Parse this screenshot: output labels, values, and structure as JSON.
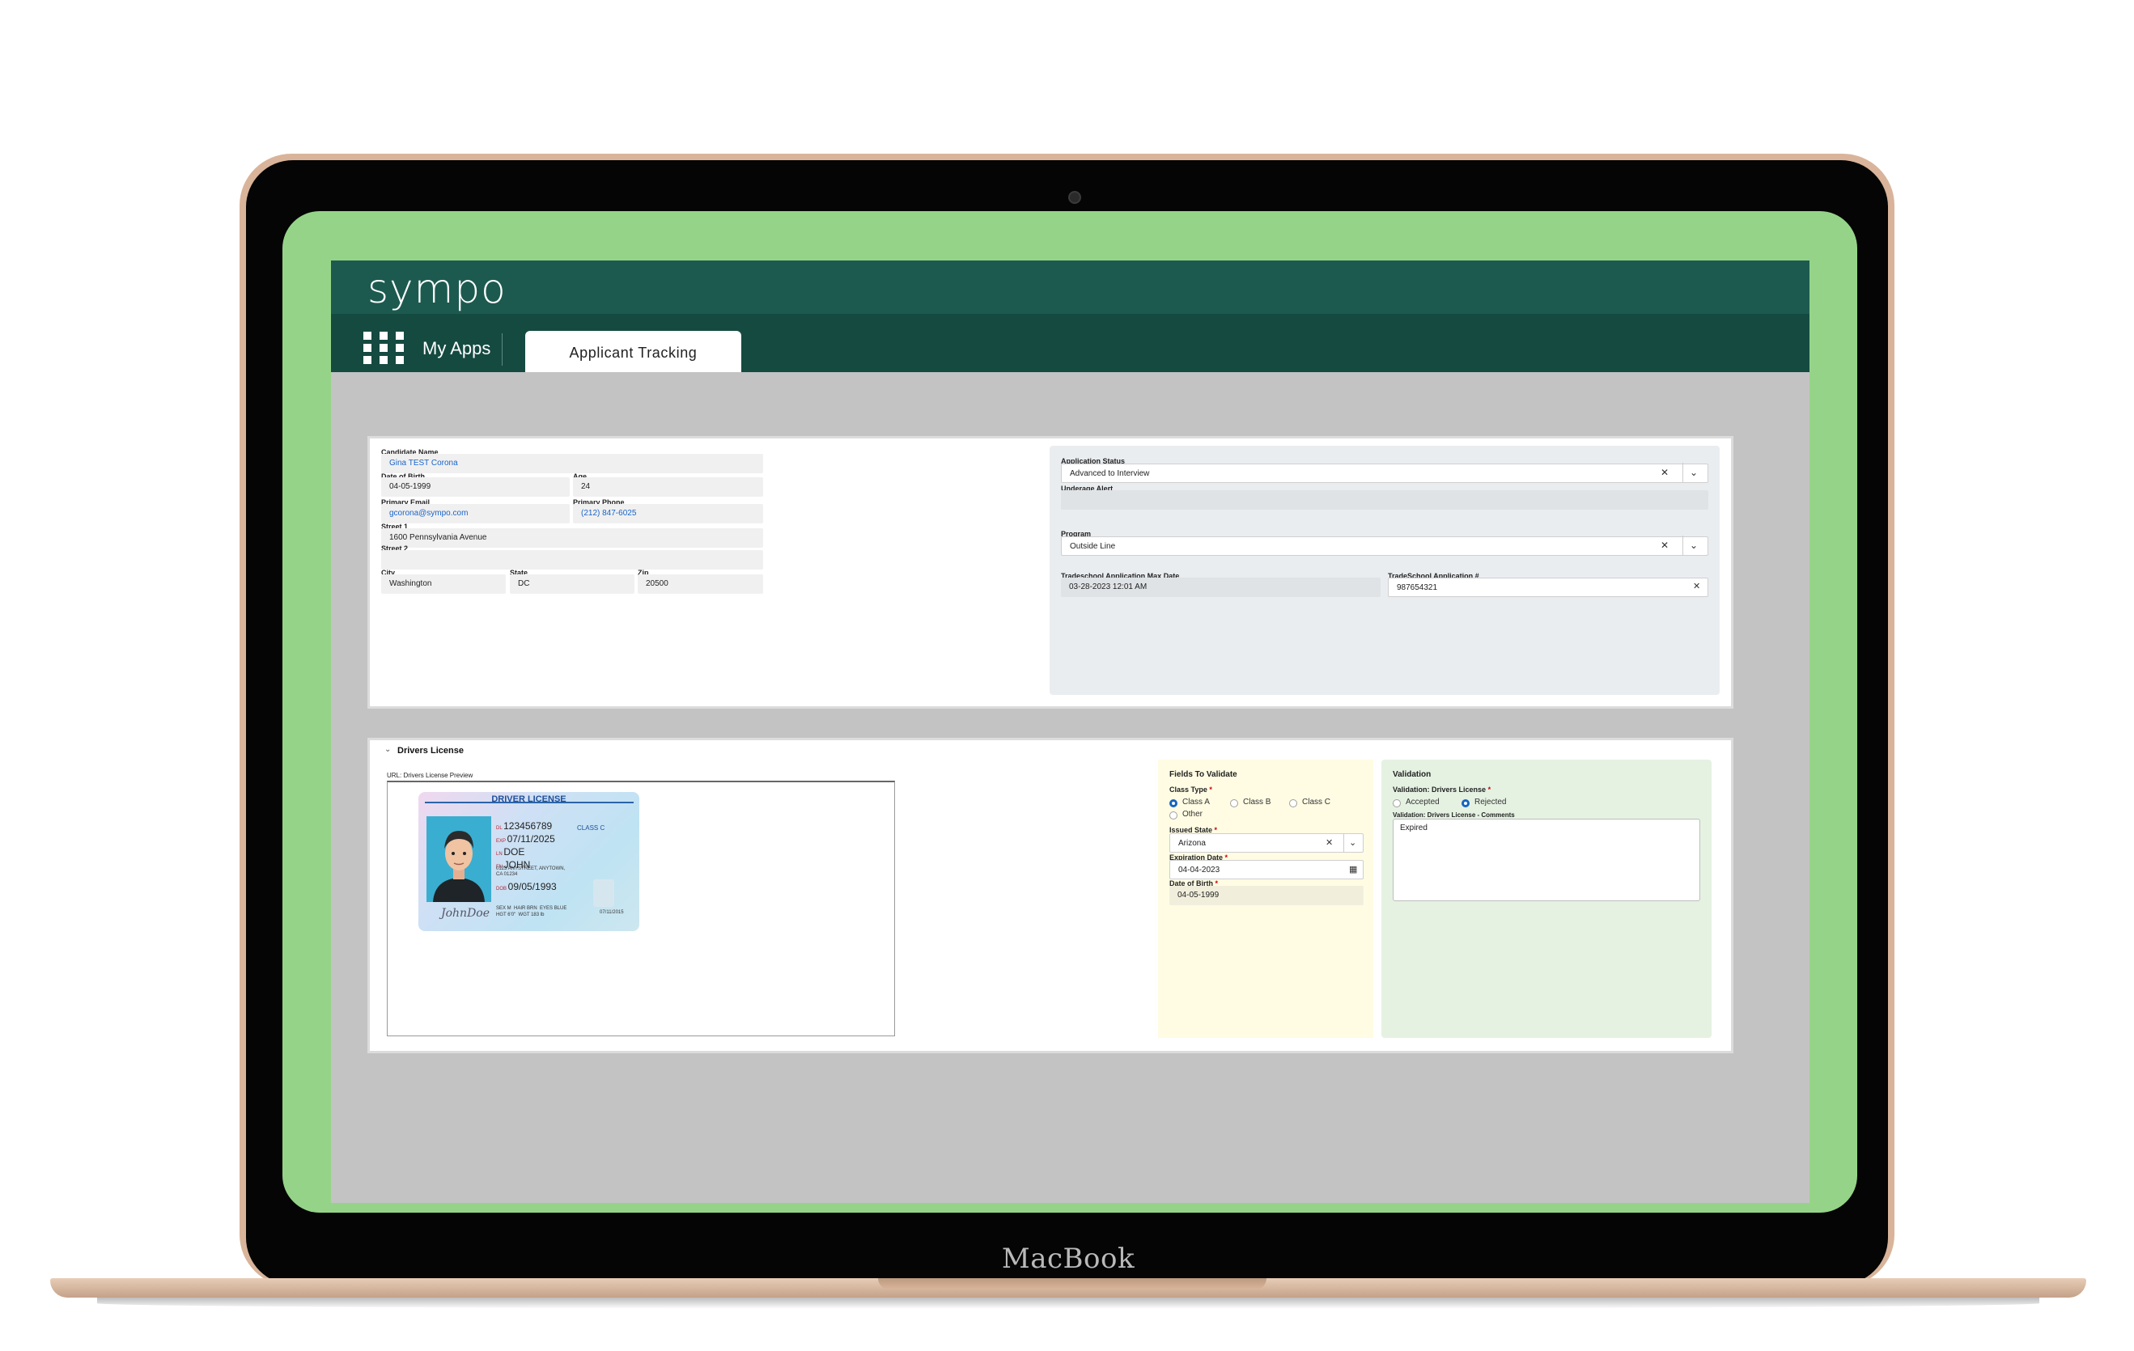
{
  "laptop": {
    "brand_label": "MacBook"
  },
  "app": {
    "logo": "sympo",
    "nav": {
      "my_apps": "My Apps",
      "active_tab": "Applicant Tracking"
    }
  },
  "applicant": {
    "candidate_name": {
      "label": "Candidate Name",
      "value": "Gina TEST Corona"
    },
    "dob": {
      "label": "Date of Birth",
      "value": "04-05-1999"
    },
    "age": {
      "label": "Age",
      "value": "24"
    },
    "email": {
      "label": "Primary Email",
      "value": "gcorona@sympo.com"
    },
    "phone": {
      "label": "Primary Phone",
      "value": "(212) 847-6025"
    },
    "street1": {
      "label": "Street 1",
      "value": "1600 Pennsylvania Avenue"
    },
    "street2": {
      "label": "Street 2",
      "value": ""
    },
    "city": {
      "label": "City",
      "value": "Washington"
    },
    "state": {
      "label": "State",
      "value": "DC"
    },
    "zip": {
      "label": "Zip",
      "value": "20500"
    }
  },
  "application": {
    "status": {
      "label": "Application Status",
      "value": "Advanced to Interview"
    },
    "underage_alert": {
      "label": "Underage Alert",
      "value": ""
    },
    "program": {
      "label": "Program",
      "value": "Outside Line"
    },
    "max_date": {
      "label": "Tradeschool Application Max Date",
      "value": "03-28-2023 12:01 AM"
    },
    "app_number": {
      "label": "TradeSchool Application #",
      "value": "987654321"
    }
  },
  "drivers_license": {
    "section_title": "Drivers License",
    "url_label": "URL: Drivers License Preview",
    "card": {
      "header": "DRIVER LICENSE",
      "class": "CLASS C",
      "dl": "123456789",
      "exp": "07/11/2025",
      "ln": "DOE",
      "fn": "JOHN",
      "address": "0123 ANYSTREET, ANYTOWN, CA 01234",
      "dob": "09/05/1993",
      "sex": "SEX M",
      "hair": "HAIR BRN",
      "eyes": "EYES BLUE",
      "hgt": "HGT 6'0\"",
      "wgt": "WGT 183 lb",
      "iss": "07/11/2015",
      "signature": "JohnDoe"
    },
    "fields_to_validate": {
      "title": "Fields To Validate",
      "class_type_label": "Class Type",
      "class_options": [
        "Class A",
        "Class B",
        "Class C",
        "Other"
      ],
      "class_selected": "Class A",
      "issued_state_label": "Issued State",
      "issued_state": "Arizona",
      "expiration_label": "Expiration Date",
      "expiration": "04-04-2023",
      "dob_label": "Date of Birth",
      "dob": "04-05-1999"
    },
    "validation": {
      "title": "Validation",
      "dl_label": "Validation: Drivers License",
      "options": [
        "Accepted",
        "Rejected"
      ],
      "selected": "Rejected",
      "comments_label": "Validation: Drivers License - Comments",
      "comments": "Expired"
    }
  },
  "colors": {
    "header": "#1c5a50",
    "nav": "#154a41",
    "screen_border": "#95d488",
    "accent": "#1565c0",
    "link": "#1a64c8"
  },
  "icons": [
    "apps-grid-icon",
    "clear-icon",
    "chevron-down-icon",
    "calendar-icon",
    "collapse-chevron-icon"
  ]
}
